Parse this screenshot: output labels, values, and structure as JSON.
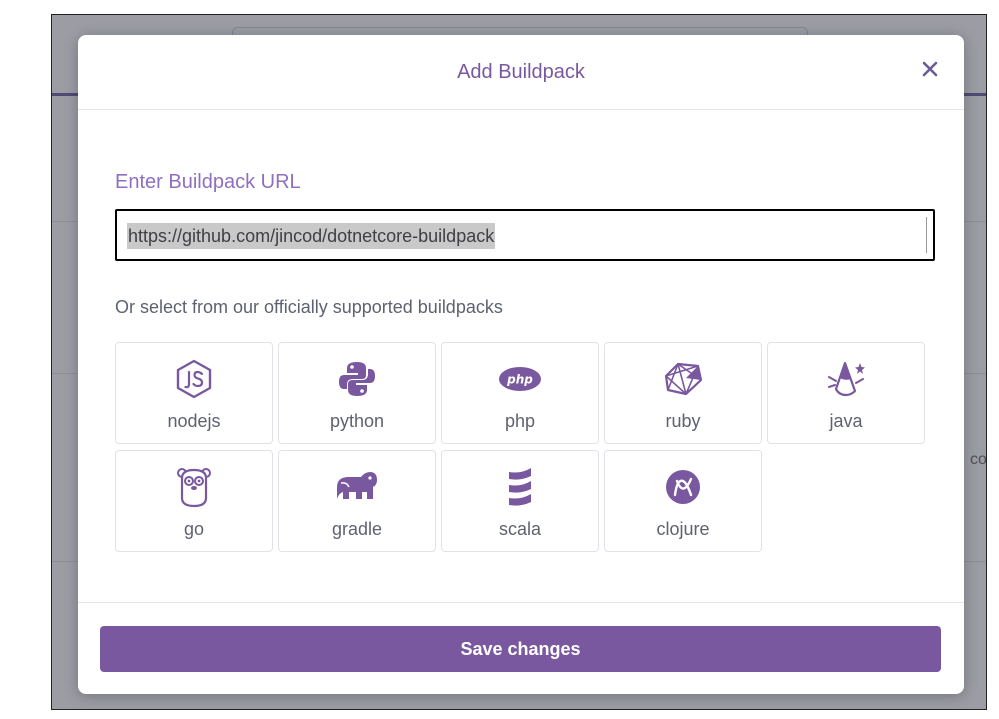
{
  "background": {
    "partial_text": "co"
  },
  "modal": {
    "title": "Add Buildpack",
    "close_symbol": "×",
    "url_label": "Enter Buildpack URL",
    "url_value": "https://github.com/jincod/dotnetcore-buildpack",
    "select_label": "Or select from our officially supported buildpacks",
    "save_label": "Save changes"
  },
  "buildpacks": [
    {
      "label": "nodejs",
      "icon": "nodejs-icon"
    },
    {
      "label": "python",
      "icon": "python-icon"
    },
    {
      "label": "php",
      "icon": "php-icon"
    },
    {
      "label": "ruby",
      "icon": "ruby-icon"
    },
    {
      "label": "java",
      "icon": "java-icon"
    },
    {
      "label": "go",
      "icon": "go-gopher-icon"
    },
    {
      "label": "gradle",
      "icon": "gradle-elephant-icon"
    },
    {
      "label": "scala",
      "icon": "scala-icon"
    },
    {
      "label": "clojure",
      "icon": "clojure-icon"
    }
  ],
  "colors": {
    "brand_purple": "#79589f",
    "label_purple": "#8f6fbf",
    "text_gray": "#5e6270",
    "tile_border": "#e1e2e8"
  }
}
